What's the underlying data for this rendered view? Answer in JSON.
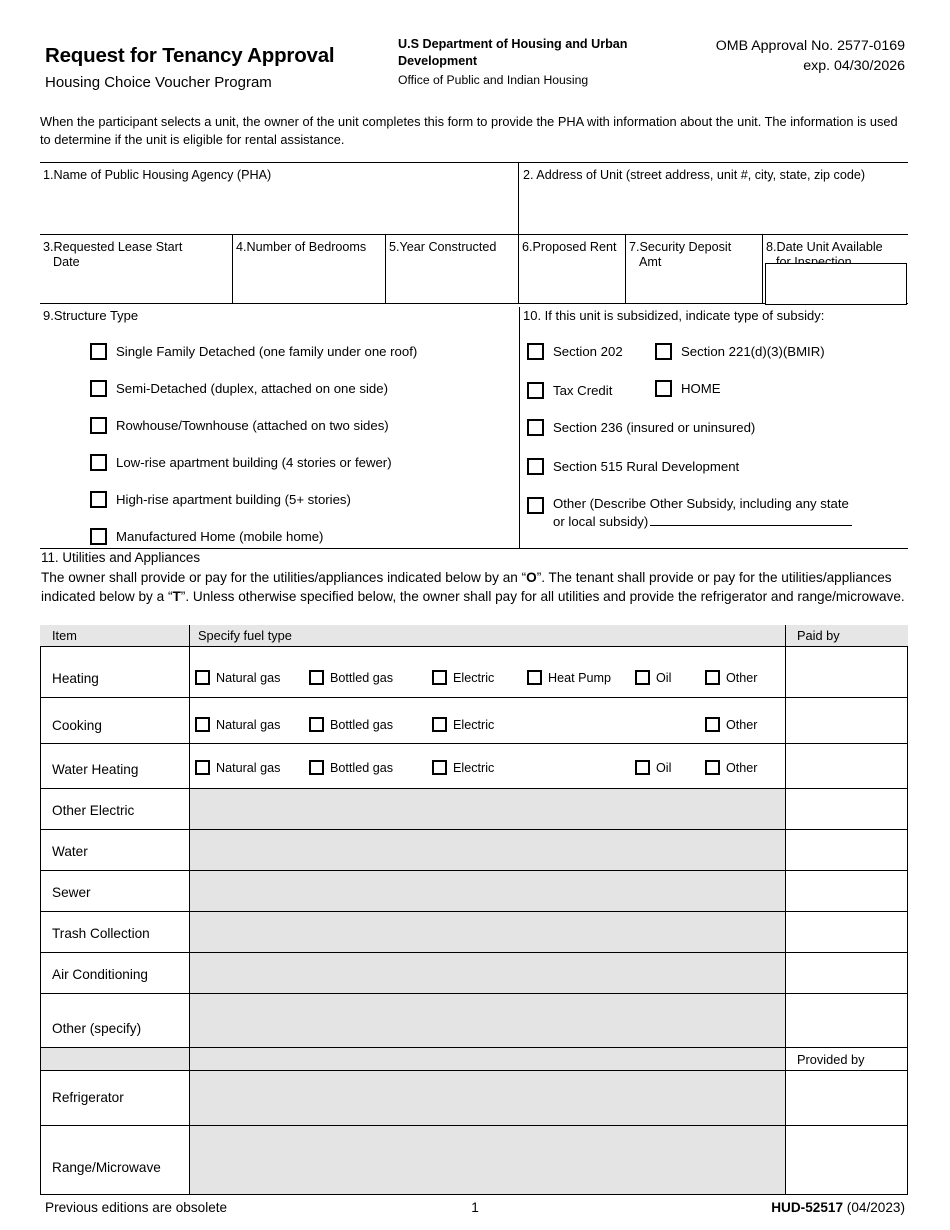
{
  "header": {
    "title": "Request for Tenancy Approval",
    "subtitle": "Housing Choice Voucher Program",
    "agency": "U.S Department of Housing and Urban Development",
    "office": "Office of Public and Indian Housing",
    "omb_approval": "OMB Approval No. 2577-0169",
    "omb_exp": "exp. 04/30/2026"
  },
  "intro": "When the participant selects a unit, the owner of the unit completes this form to provide the PHA with information about the unit. The information is used to determine if the unit is eligible for rental assistance.",
  "fields": {
    "f1_label": "1.Name of Public Housing Agency (PHA)",
    "f2_label": "2.  Address of Unit (street address, unit #, city, state, zip code)",
    "f3_label": "3.Requested Lease Start",
    "f3_label2": "Date",
    "f4_label": "4.Number of Bedrooms",
    "f5_label": "5.Year Constructed",
    "f6_label": "6.Proposed Rent",
    "f7_label": "7.Security Deposit",
    "f7_label2": "Amt",
    "f8_label": "8.Date Unit Available",
    "f8_label2": "for Inspection",
    "f1_value": "",
    "f2_value": "",
    "f3_value": "",
    "f4_value": "",
    "f5_value": "",
    "f6_value": "",
    "f7_value": "",
    "f8_value": ""
  },
  "structure_type": {
    "heading": "9.Structure Type",
    "options": [
      {
        "label": "Single Family Detached (one family under one roof)",
        "checked": false
      },
      {
        "label": "Semi-Detached (duplex, attached on one side)",
        "checked": false
      },
      {
        "label": "Rowhouse/Townhouse (attached on two sides)",
        "checked": false
      },
      {
        "label": "Low-rise apartment building (4 stories or fewer)",
        "checked": false
      },
      {
        "label": "High-rise apartment building (5+ stories)",
        "checked": false
      },
      {
        "label": "Manufactured Home (mobile home)",
        "checked": false
      }
    ]
  },
  "subsidy": {
    "heading": "10.  If this unit is subsidized, indicate type of subsidy:",
    "options": [
      {
        "label": "Section 202",
        "checked": false
      },
      {
        "label": "Section 221(d)(3)(BMIR)",
        "checked": false
      },
      {
        "label": "Tax Credit",
        "checked": false
      },
      {
        "label": "HOME",
        "checked": false
      },
      {
        "label": "Section 236 (insured or uninsured)",
        "checked": false
      },
      {
        "label": "Section 515 Rural Development",
        "checked": false
      }
    ],
    "other_label_line1": "Other (Describe Other Subsidy, including any state",
    "other_label_line2": "or local subsidy)",
    "other_checked": false,
    "other_value": ""
  },
  "utilities_section": {
    "heading": "11.  Utilities and Appliances",
    "body_part1": "The owner shall provide or pay for the utilities/appliances indicated below by an “",
    "body_O": "O",
    "body_part2": "”. The tenant shall provide or pay for the utilities/appliances indicated below by a “",
    "body_T": "T",
    "body_part3": "”. Unless otherwise specified below, the owner shall pay for all utilities and provide the refrigerator and range/microwave.",
    "columns": {
      "item": "Item",
      "fuel": "Specify fuel type",
      "paid_by": "Paid by",
      "provided_by": "Provided by"
    },
    "rows": [
      {
        "item": "Heating",
        "fuels": [
          "Natural gas",
          "Bottled gas",
          "Electric",
          "Heat Pump",
          "Oil",
          "Other"
        ],
        "paid_by": ""
      },
      {
        "item": "Cooking",
        "fuels": [
          "Natural gas",
          "Bottled gas",
          "Electric",
          "Other"
        ],
        "paid_by": ""
      },
      {
        "item": "Water Heating",
        "fuels": [
          "Natural gas",
          "Bottled gas",
          "Electric",
          "Oil",
          "Other"
        ],
        "paid_by": ""
      },
      {
        "item": "Other Electric",
        "fuels": [],
        "paid_by": ""
      },
      {
        "item": "Water",
        "fuels": [],
        "paid_by": ""
      },
      {
        "item": "Sewer",
        "fuels": [],
        "paid_by": ""
      },
      {
        "item": "Trash Collection",
        "fuels": [],
        "paid_by": ""
      },
      {
        "item": "Air Conditioning",
        "fuels": [],
        "paid_by": ""
      },
      {
        "item": "Other (specify)",
        "fuels": [],
        "paid_by": ""
      },
      {
        "item": "Refrigerator",
        "fuels": [],
        "paid_by": ""
      },
      {
        "item": "Range/Microwave",
        "fuels": [],
        "paid_by": ""
      }
    ]
  },
  "footer": {
    "left": "Previous editions are obsolete",
    "page": "1",
    "form_id": "HUD-52517",
    "form_date": "(04/2023)"
  },
  "colors": {
    "header_gray": "#e6e6e6",
    "shade_gray": "#e4e4e4",
    "rule": "#000000"
  }
}
